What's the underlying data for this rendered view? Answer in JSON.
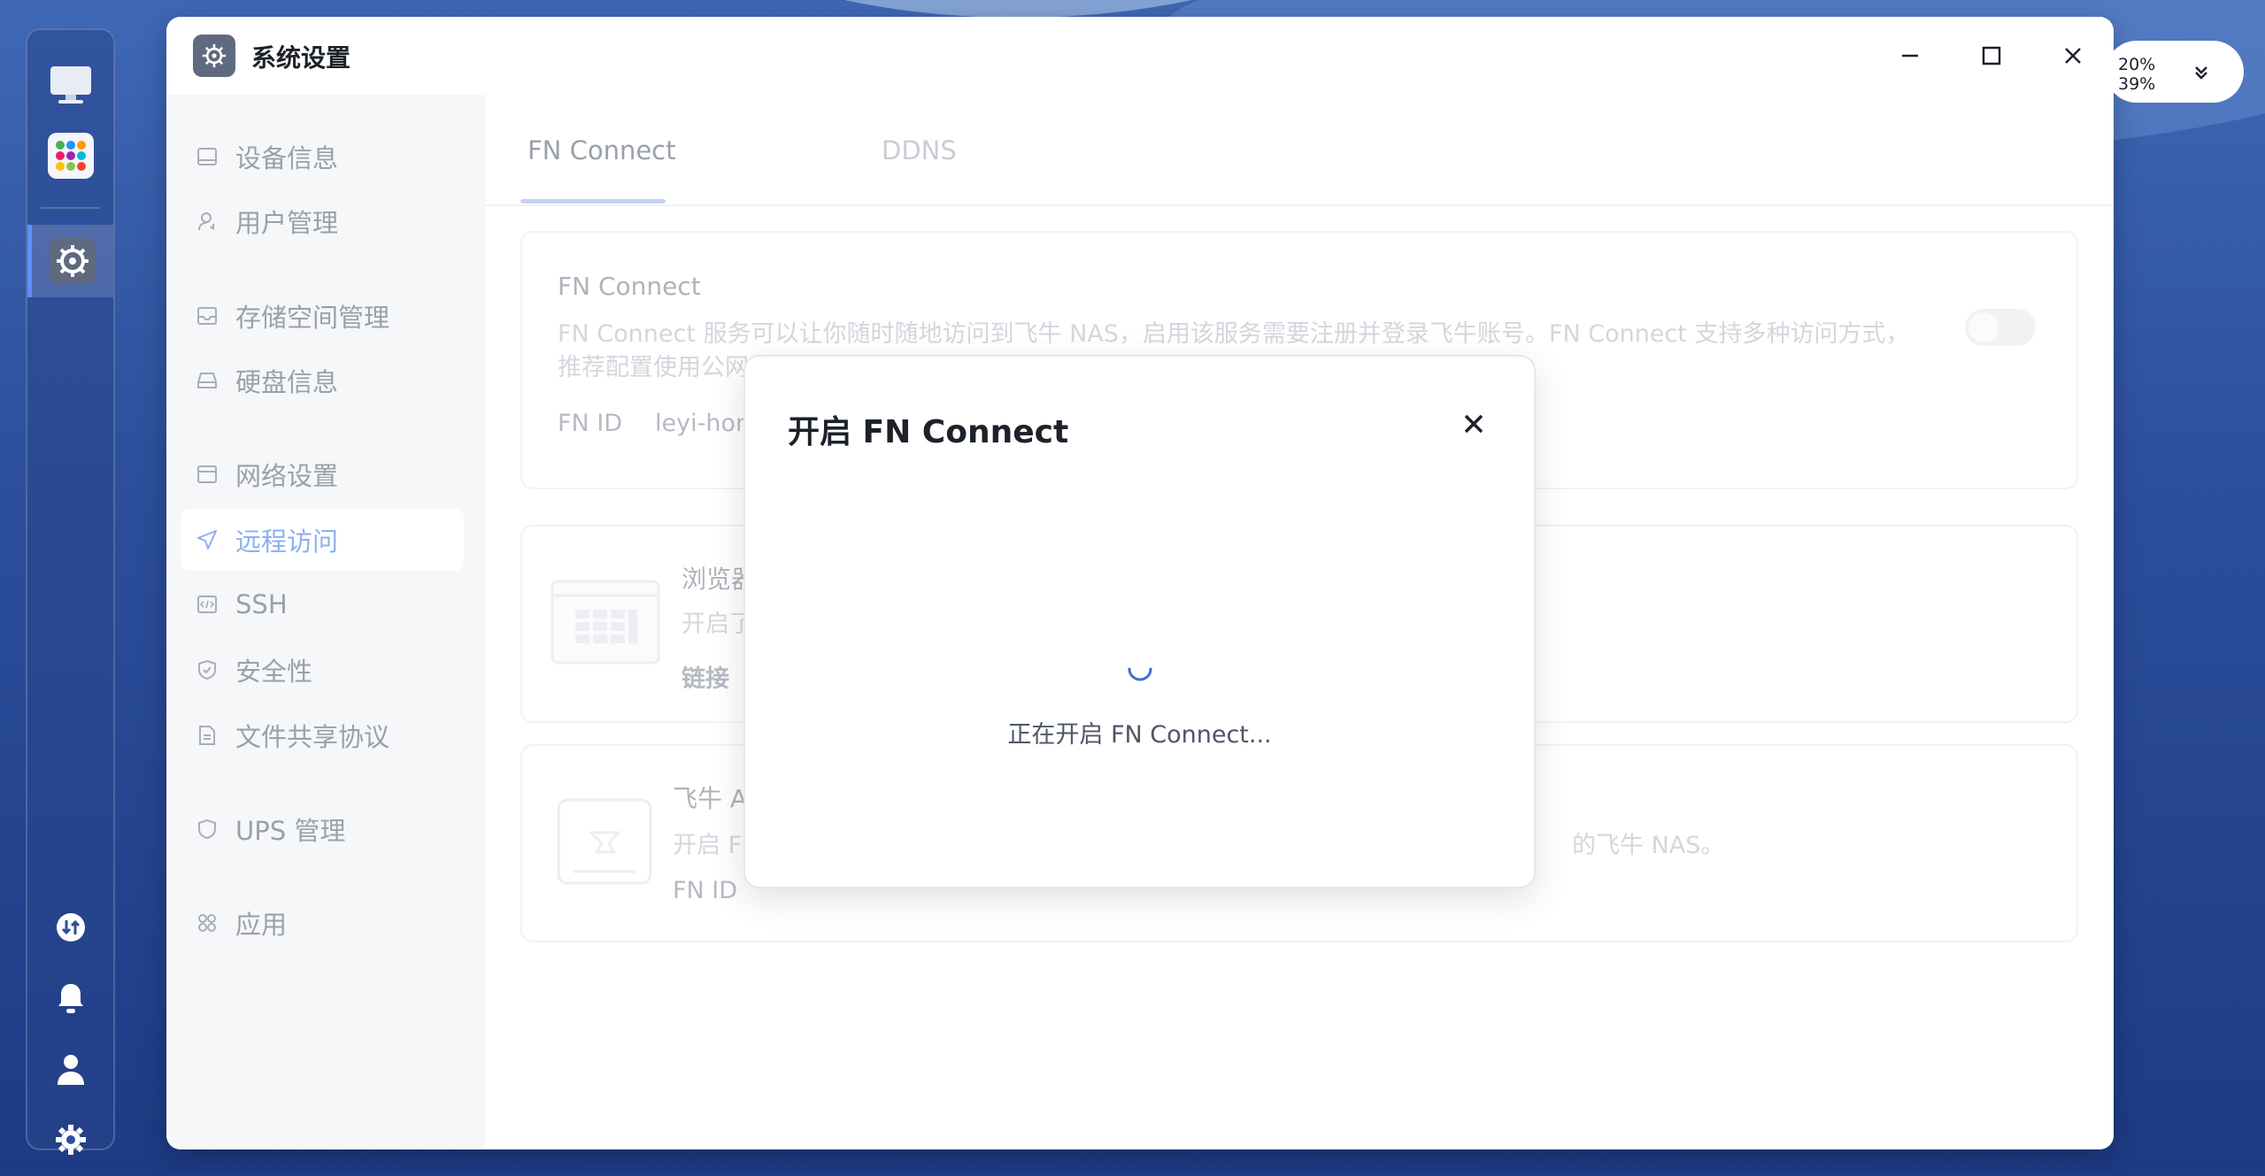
{
  "window": {
    "title": "系统设置"
  },
  "tray": {
    "stat1": "20%",
    "stat2": "39%"
  },
  "sidebar": {
    "items": [
      {
        "label": "设备信息",
        "icon": "monitor-icon"
      },
      {
        "label": "用户管理",
        "icon": "user-icon"
      },
      {
        "label": "存储空间管理",
        "icon": "storage-icon"
      },
      {
        "label": "硬盘信息",
        "icon": "disk-icon"
      },
      {
        "label": "网络设置",
        "icon": "network-icon"
      },
      {
        "label": "远程访问",
        "icon": "send-icon",
        "active": true
      },
      {
        "label": "SSH",
        "icon": "code-icon"
      },
      {
        "label": "安全性",
        "icon": "shield-check-icon"
      },
      {
        "label": "文件共享协议",
        "icon": "file-icon"
      },
      {
        "label": "UPS 管理",
        "icon": "ups-icon"
      },
      {
        "label": "应用",
        "icon": "apps-icon"
      }
    ]
  },
  "tabs": [
    {
      "label": "FN Connect",
      "active": true
    },
    {
      "label": "DDNS",
      "active": false
    }
  ],
  "cards": {
    "fn_connect": {
      "title": "FN Connect",
      "desc_line1": "FN Connect 服务可以让你随时随地访问到飞牛 NAS，启用该服务需要注册并登录飞牛账号。FN Connect 支持多种访问方式，",
      "desc_line2": "推荐配置使用公网 IP 及 DDNS，若使用中继转发，因流量成本会限速。",
      "id_label": "FN ID",
      "id_value": "leyi-hon"
    },
    "browser": {
      "title": "浏览器",
      "desc": "开启了",
      "link_label": "链接"
    },
    "app": {
      "title": "飞牛 A",
      "desc_left": "开启 F",
      "desc_right": "的飞牛 NAS。",
      "id_label": "FN ID"
    }
  },
  "modal": {
    "title": "开启 FN Connect",
    "message": "正在开启 FN Connect..."
  },
  "colors": {
    "accent": "#3a6fd8",
    "spinner": "#3a6fd8"
  }
}
